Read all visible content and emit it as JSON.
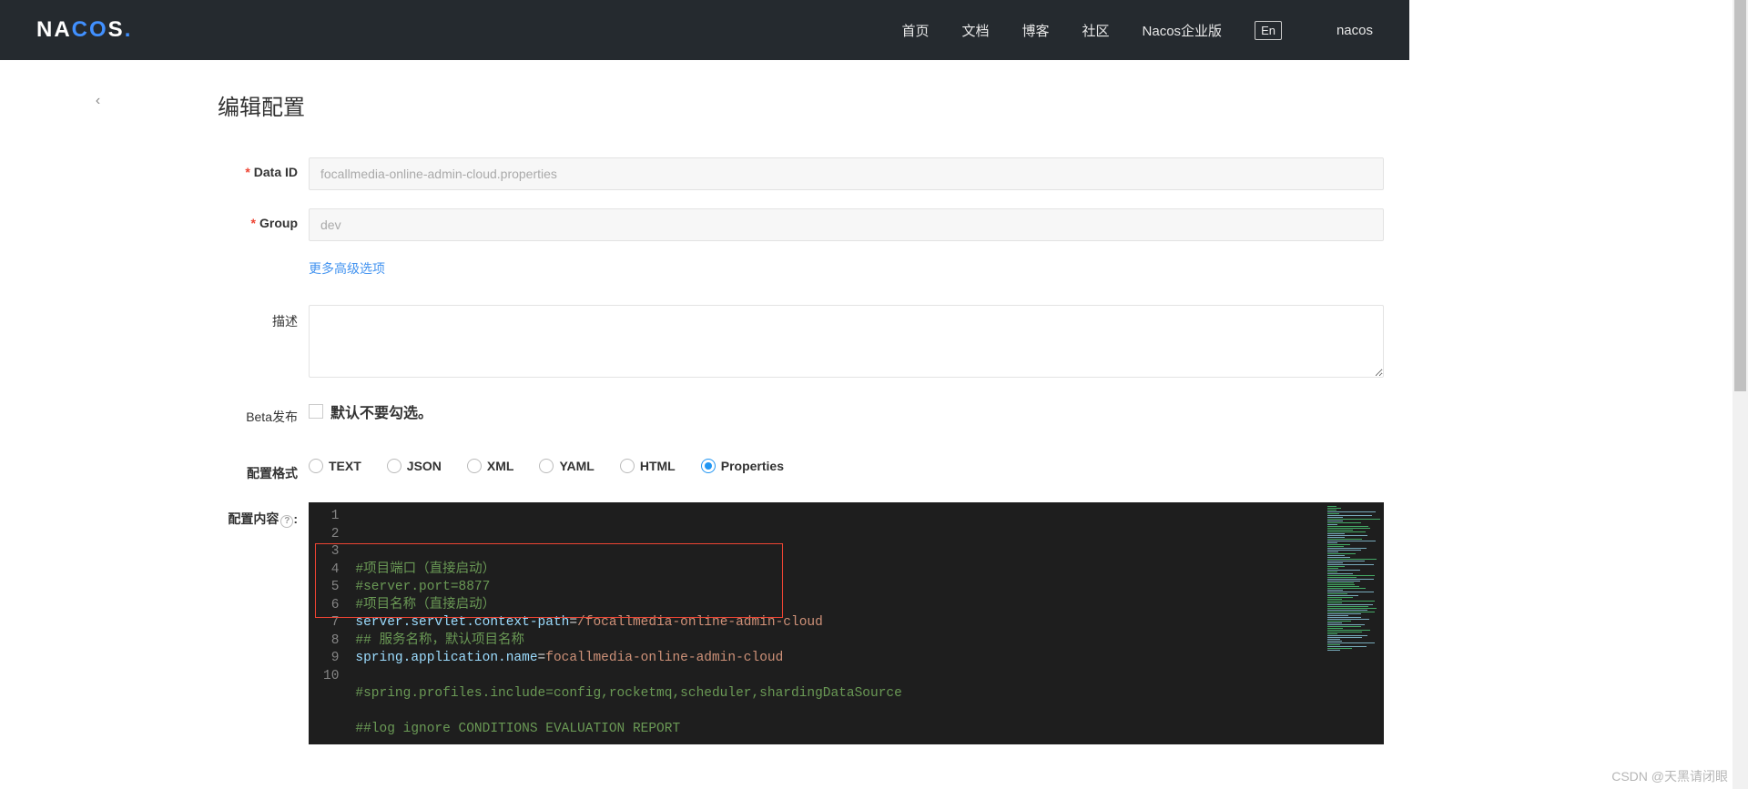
{
  "header": {
    "logo_parts": {
      "na": "NA",
      "co": "CO",
      "s": "S",
      "dot": "."
    },
    "nav": [
      "首页",
      "文档",
      "博客",
      "社区",
      "Nacos企业版"
    ],
    "lang": "En",
    "user": "nacos"
  },
  "page": {
    "title": "编辑配置",
    "back_icon": "‹"
  },
  "form": {
    "data_id": {
      "label": "Data ID",
      "value": "focallmedia-online-admin-cloud.properties"
    },
    "group": {
      "label": "Group",
      "value": "dev"
    },
    "advanced": "更多高级选项",
    "desc": {
      "label": "描述",
      "value": ""
    },
    "beta": {
      "label": "Beta发布",
      "hint": "默认不要勾选。"
    },
    "format": {
      "label": "配置格式",
      "options": [
        "TEXT",
        "JSON",
        "XML",
        "YAML",
        "HTML",
        "Properties"
      ],
      "selected": "Properties"
    },
    "content": {
      "label": "配置内容",
      "help": "?"
    }
  },
  "code": {
    "lines": [
      {
        "n": 1,
        "type": "comment",
        "text": "#项目端口（直接启动）"
      },
      {
        "n": 2,
        "type": "comment",
        "text": "#server.port=8877"
      },
      {
        "n": 3,
        "type": "comment",
        "text": "#项目名称（直接启动）"
      },
      {
        "n": 4,
        "type": "kv",
        "key": "server.servlet.context-path",
        "val": "/focallmedia-online-admin-cloud"
      },
      {
        "n": 5,
        "type": "comment",
        "text": "## 服务名称，默认项目名称"
      },
      {
        "n": 6,
        "type": "kv",
        "key": "spring.application.name",
        "val": "focallmedia-online-admin-cloud"
      },
      {
        "n": 7,
        "type": "blank",
        "text": ""
      },
      {
        "n": 8,
        "type": "comment",
        "text": "#spring.profiles.include=config,rocketmq,scheduler,shardingDataSource"
      },
      {
        "n": 9,
        "type": "blank",
        "text": ""
      },
      {
        "n": 10,
        "type": "comment",
        "text": "##log ignore CONDITIONS EVALUATION REPORT"
      }
    ]
  },
  "watermark": "CSDN @天黑请闭眼"
}
